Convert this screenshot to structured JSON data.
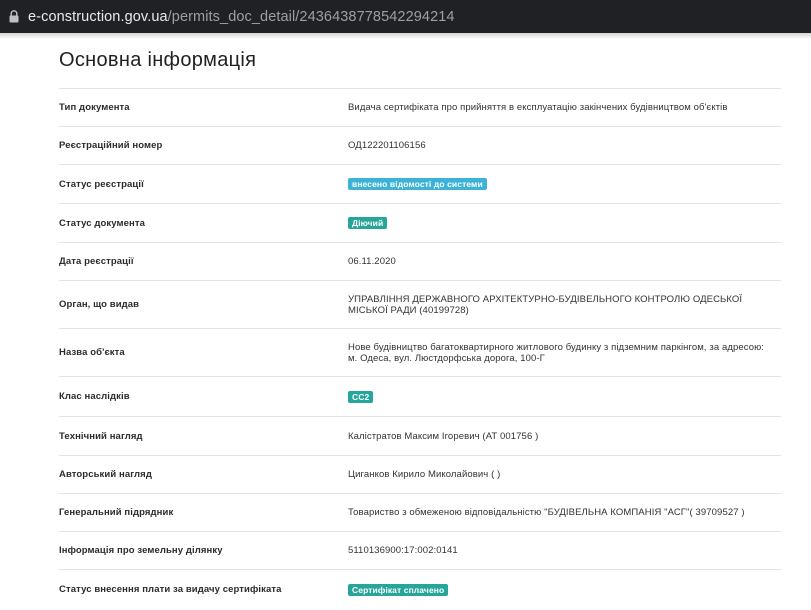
{
  "browser": {
    "url_host": "e-construction.gov.ua",
    "url_path": "/permits_doc_detail/2436438778542294214"
  },
  "page": {
    "title": "Основна інформація"
  },
  "fields": [
    {
      "label": "Тип документа",
      "value": "Видача сертифіката про прийняття в експлуатацію закінчених будівництвом об'єктів"
    },
    {
      "label": "Реєстраційний номер",
      "value": "ОД122201106156"
    },
    {
      "label": "Статус реєстрації",
      "badge": "внесено відомості до системи",
      "badge_color": "#3bb3d9"
    },
    {
      "label": "Статус документа",
      "badge": "Діючий",
      "badge_color": "#26a69a"
    },
    {
      "label": "Дата реєстрації",
      "value": "06.11.2020"
    },
    {
      "label": "Орган, що видав",
      "value": "УПРАВЛІННЯ ДЕРЖАВНОГО АРХІТЕКТУРНО-БУДІВЕЛЬНОГО КОНТРОЛЮ ОДЕСЬКОЇ МІСЬКОЇ РАДИ (40199728)"
    },
    {
      "label": "Назва об'єкта",
      "value": "Нове будівництво багатоквартирного житлового будинку з підземним паркінгом, за адресою: м. Одеса, вул. Люстдорфська дорога, 100-Г"
    },
    {
      "label": "Клас наслідків",
      "badge": "СС2",
      "badge_color": "#26a69a"
    },
    {
      "label": "Технічний нагляд",
      "value": "Калістратов Максим Ігоревич (АТ 001756 )"
    },
    {
      "label": "Авторський нагляд",
      "value": "Циганков Кирило Миколайович ( )"
    },
    {
      "label": "Генеральний підрядник",
      "value": "Товариство з обмеженою відповідальністю \"БУДІВЕЛЬНА КОМПАНІЯ \"АСГ\"( 39709527 )"
    },
    {
      "label": "Інформація про земельну ділянку",
      "value": "5110136900:17:002:0141"
    },
    {
      "label": "Статус внесення плати за видачу сертифіката",
      "badge": "Сертифікат сплачено",
      "badge_color": "#26a69a"
    }
  ],
  "icons": {
    "address_bar": "lock-icon"
  }
}
